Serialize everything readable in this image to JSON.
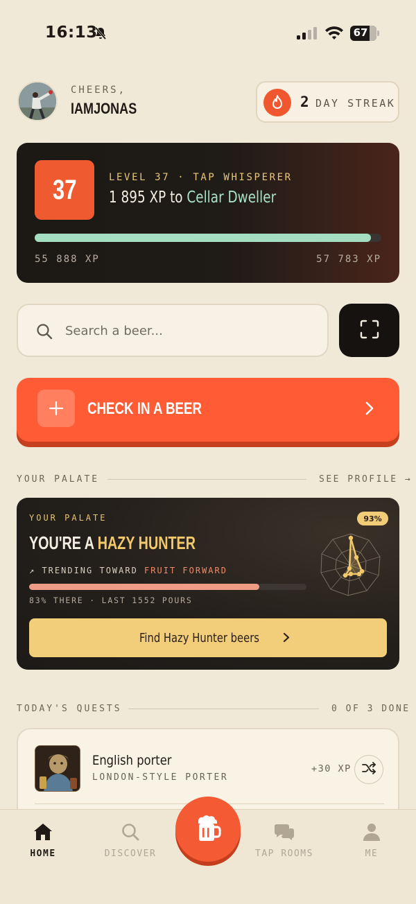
{
  "status_bar": {
    "time": "16:13",
    "battery": "67"
  },
  "header": {
    "greeting": "CHEERS,",
    "username": "IAMJONAS",
    "streak_count": "2",
    "streak_label": "DAY STREAK"
  },
  "level": {
    "number": "37",
    "tag": "LEVEL 37 · TAP WHISPERER",
    "xp_prefix": "1 895 XP to ",
    "next_title": "Cellar Dweller",
    "xp_current": "55 888 XP",
    "xp_next": "57 783 XP",
    "progress": 0.97
  },
  "search": {
    "placeholder": "Search a beer..."
  },
  "checkin": {
    "label": "CHECK IN A BEER"
  },
  "palate_section": {
    "title": "YOUR PALATE",
    "link": "SEE PROFILE →"
  },
  "palate": {
    "eyebrow": "YOUR PALATE",
    "headline_prefix": "YOU'RE A ",
    "headline_highlight": "HAZY HUNTER",
    "trend_prefix": "↗ TRENDING TOWARD ",
    "trend_target": "FRUIT FORWARD",
    "progress": 0.83,
    "meta": "83% THERE · LAST 1552 POURS",
    "match_pct": "93%",
    "button_label": "Find Hazy Hunter beers"
  },
  "quests_section": {
    "title": "TODAY'S QUESTS",
    "status": "0 OF 3 DONE"
  },
  "quests": [
    {
      "name": "English porter",
      "style": "LONDON-STYLE PORTER",
      "xp": "+30 XP"
    }
  ],
  "nav": {
    "home": "HOME",
    "discover": "DISCOVER",
    "taprooms": "TAP ROOMS",
    "me": "ME"
  },
  "colors": {
    "accent": "#ff5c35",
    "background": "#f1e9d8",
    "xp_bar": "#a4ddbf",
    "palate_bar": "#ee9c86",
    "gold": "#f2cd7a"
  }
}
